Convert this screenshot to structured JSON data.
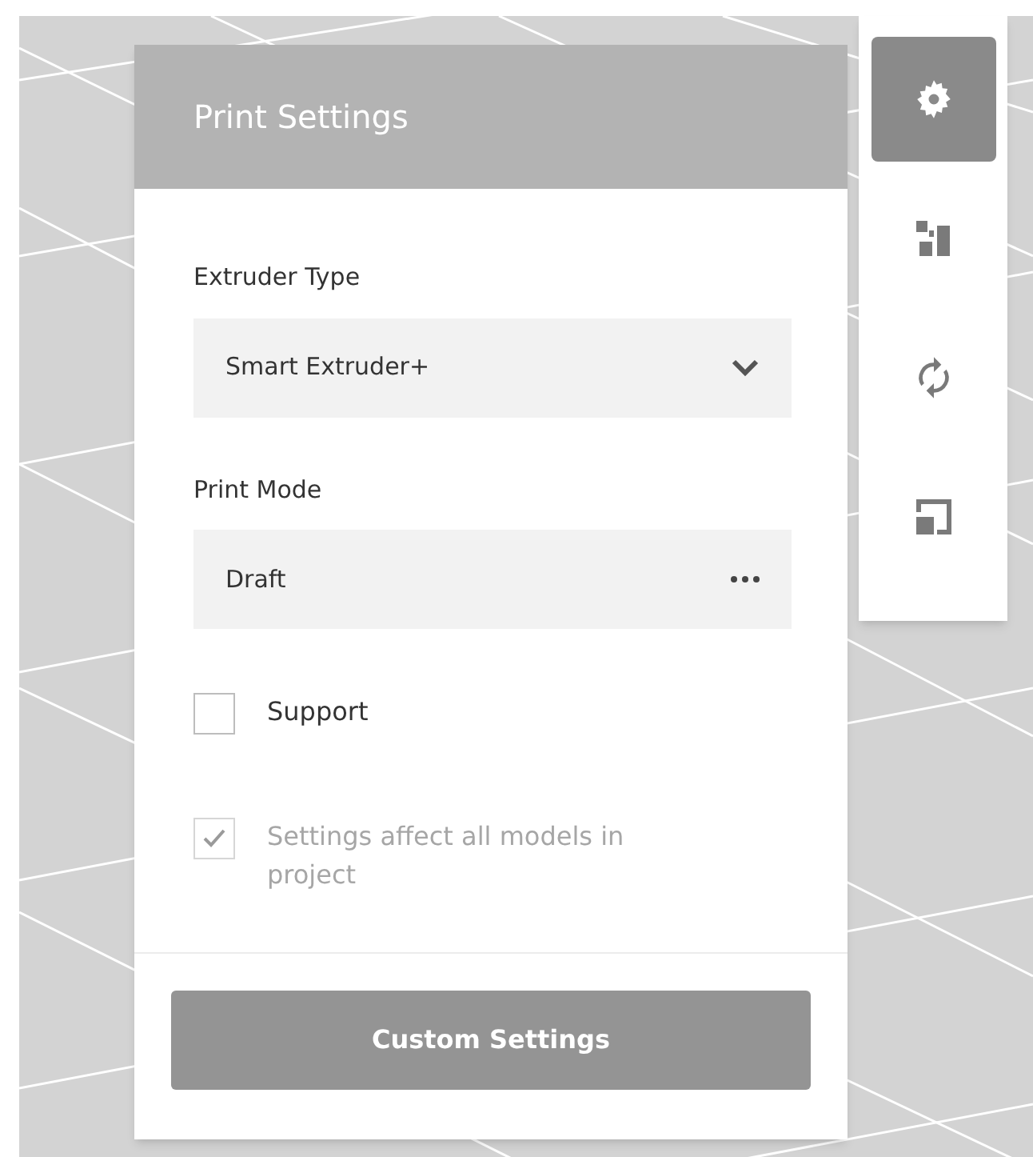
{
  "panel": {
    "title": "Print Settings"
  },
  "fields": [
    {
      "kind": "dropdown",
      "label": "Extruder Type",
      "value": "Smart Extruder+"
    },
    {
      "kind": "menu",
      "label": "Print Mode",
      "value": "Draft"
    }
  ],
  "checkboxes": [
    {
      "label": "Support",
      "checked": false,
      "disabled": false
    },
    {
      "label": "Settings affect all models in project",
      "checked": true,
      "disabled": true
    }
  ],
  "button": {
    "label": "Custom Settings"
  },
  "toolbar": [
    {
      "kind": "settings",
      "selected": true
    },
    {
      "kind": "arrange",
      "selected": false
    },
    {
      "kind": "rotate",
      "selected": false
    },
    {
      "kind": "scale",
      "selected": false
    }
  ]
}
